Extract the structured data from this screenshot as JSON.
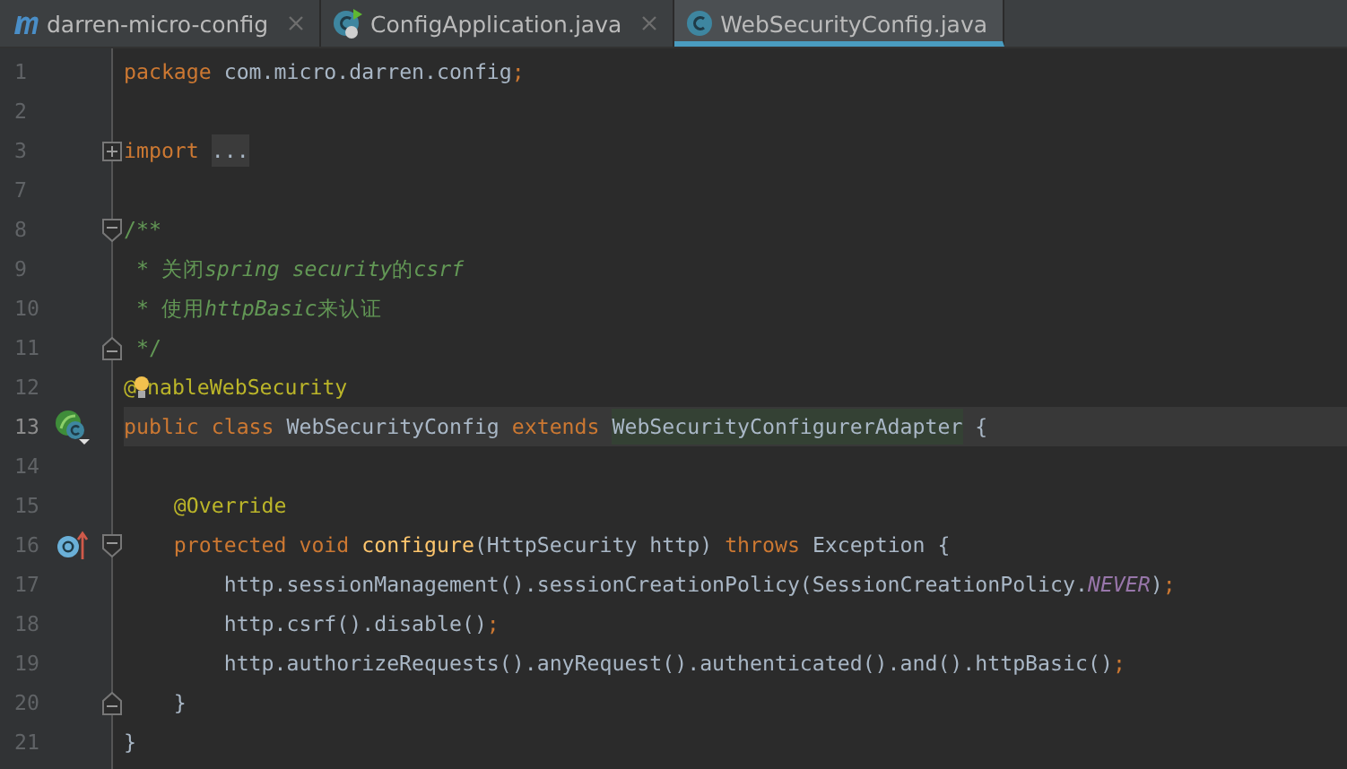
{
  "tabs": [
    {
      "label": "darren-micro-config",
      "kind": "maven",
      "selected": false
    },
    {
      "label": "ConfigApplication.java",
      "kind": "spring-class",
      "selected": false
    },
    {
      "label": "WebSecurityConfig.java",
      "kind": "class",
      "selected": true
    }
  ],
  "lines": [
    {
      "number": "1",
      "current": false,
      "tokens": [
        {
          "text": "package ",
          "kind": "kw"
        },
        {
          "text": "com.micro.darren.config",
          "kind": "plain"
        },
        {
          "text": ";",
          "kind": "kw"
        }
      ]
    },
    {
      "number": "2",
      "current": false
    },
    {
      "number": "3",
      "current": false,
      "fold": {
        "kind": "expand"
      },
      "tokens": [
        {
          "text": "import ",
          "kind": "kw"
        },
        {
          "text": "...",
          "kind": "folded"
        }
      ]
    },
    {
      "number": "7",
      "current": false
    },
    {
      "number": "8",
      "current": false,
      "fold": {
        "kind": "start"
      },
      "tokens": [
        {
          "text": "/**",
          "kind": "comment"
        }
      ]
    },
    {
      "number": "9",
      "current": false,
      "tokens": [
        {
          "text": " * 关闭",
          "kind": "comment"
        },
        {
          "text": "spring security",
          "kind": "doc"
        },
        {
          "text": "的",
          "kind": "comment"
        },
        {
          "text": "csrf",
          "kind": "doc"
        }
      ]
    },
    {
      "number": "10",
      "current": false,
      "tokens": [
        {
          "text": " * 使用",
          "kind": "comment"
        },
        {
          "text": "httpBasic",
          "kind": "doc"
        },
        {
          "text": "来认证",
          "kind": "comment"
        }
      ]
    },
    {
      "number": "11",
      "current": false,
      "fold": {
        "kind": "end"
      },
      "tokens": [
        {
          "text": " */",
          "kind": "comment"
        }
      ]
    },
    {
      "number": "12",
      "current": false,
      "tokens": [
        {
          "text": "@",
          "kind": "annot"
        },
        {
          "kind": "bulb"
        },
        {
          "text": "nableWebSecurity",
          "kind": "annot"
        }
      ]
    },
    {
      "number": "13",
      "current": true,
      "gutter": {
        "kind": "spring-class"
      },
      "tokens": [
        {
          "text": "public class ",
          "kind": "kw"
        },
        {
          "text": "WebSecurityConfig ",
          "kind": "plain"
        },
        {
          "text": "extends ",
          "kind": "kw"
        },
        {
          "text": "WebSecurityConfigurerAdapter",
          "kind": "highlight"
        },
        {
          "text": " {",
          "kind": "plain"
        }
      ]
    },
    {
      "number": "14",
      "current": false
    },
    {
      "number": "15",
      "current": false,
      "tokens": [
        {
          "text": "    @Override",
          "kind": "annot"
        }
      ]
    },
    {
      "number": "16",
      "current": false,
      "gutter": {
        "kind": "override"
      },
      "fold": {
        "kind": "start"
      },
      "tokens": [
        {
          "text": "    protected void ",
          "kind": "kw"
        },
        {
          "text": "configure",
          "kind": "method"
        },
        {
          "text": "(HttpSecurity http) ",
          "kind": "plain"
        },
        {
          "text": "throws ",
          "kind": "kw"
        },
        {
          "text": "Exception {",
          "kind": "plain"
        }
      ]
    },
    {
      "number": "17",
      "current": false,
      "tokens": [
        {
          "text": "        http.sessionManagement().sessionCreationPolicy(SessionCreationPolicy.",
          "kind": "plain"
        },
        {
          "text": "NEVER",
          "kind": "const"
        },
        {
          "text": ")",
          "kind": "plain"
        },
        {
          "text": ";",
          "kind": "kw"
        }
      ]
    },
    {
      "number": "18",
      "current": false,
      "tokens": [
        {
          "text": "        http.csrf().disable()",
          "kind": "plain"
        },
        {
          "text": ";",
          "kind": "kw"
        }
      ]
    },
    {
      "number": "19",
      "current": false,
      "tokens": [
        {
          "text": "        http.authorizeRequests().anyRequest().authenticated().and().httpBasic()",
          "kind": "plain"
        },
        {
          "text": ";",
          "kind": "kw"
        }
      ]
    },
    {
      "number": "20",
      "current": false,
      "fold": {
        "kind": "end"
      },
      "tokens": [
        {
          "text": "    }",
          "kind": "plain"
        }
      ]
    },
    {
      "number": "21",
      "current": false,
      "tokens": [
        {
          "text": "}",
          "kind": "plain"
        }
      ]
    }
  ]
}
